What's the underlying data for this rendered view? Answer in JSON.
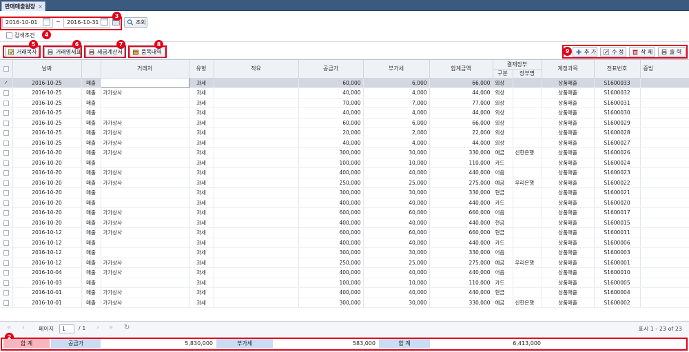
{
  "tab": {
    "title": "판매매출원장",
    "close": "×"
  },
  "search": {
    "date_from": "2016-10-01",
    "date_to": "2016-10-31",
    "tilde": "~",
    "query_label": "조회",
    "condition_label": "검색조건"
  },
  "toolbar_left": [
    {
      "label": "거래복사"
    },
    {
      "label": "거래명세표"
    },
    {
      "label": "세금계산서"
    },
    {
      "label": "품목내역"
    }
  ],
  "toolbar_right": [
    {
      "label": "추 가"
    },
    {
      "label": "수 정"
    },
    {
      "label": "삭 제"
    },
    {
      "label": "출 력"
    }
  ],
  "badges": [
    "2",
    "3",
    "4",
    "5",
    "6",
    "7",
    "8",
    "9"
  ],
  "table": {
    "headers": {
      "date": "날짜",
      "trader": "거래처",
      "type": "유형",
      "memo": "적요",
      "supply": "공급가",
      "vat": "부가세",
      "total": "합계금액",
      "settlement": "결재장부",
      "kind": "구분",
      "ledger": "장부명",
      "account": "계정과목",
      "slip": "전표번호",
      "proof": "증빙"
    },
    "rows": [
      {
        "date": "2016-10-25",
        "cat": "매출",
        "trader": "",
        "type": "과세",
        "memo": "",
        "supply": "60,000",
        "vat": "6,000",
        "total": "66,000",
        "kind": "외상",
        "ledger": "",
        "account": "상품매출",
        "slip": "S1600033",
        "sel": true
      },
      {
        "date": "2016-10-25",
        "cat": "매출",
        "trader": "가가상사",
        "type": "과세",
        "memo": "",
        "supply": "40,000",
        "vat": "4,000",
        "total": "44,000",
        "kind": "외상",
        "ledger": "",
        "account": "상품매출",
        "slip": "S1600032"
      },
      {
        "date": "2016-10-25",
        "cat": "매출",
        "trader": "",
        "type": "과세",
        "memo": "",
        "supply": "70,000",
        "vat": "7,000",
        "total": "77,000",
        "kind": "외상",
        "ledger": "",
        "account": "상품매출",
        "slip": "S1600031"
      },
      {
        "date": "2016-10-25",
        "cat": "매출",
        "trader": "",
        "type": "과세",
        "memo": "",
        "supply": "40,000",
        "vat": "4,000",
        "total": "44,000",
        "kind": "외상",
        "ledger": "",
        "account": "상품매출",
        "slip": "S1600030"
      },
      {
        "date": "2016-10-25",
        "cat": "매출",
        "trader": "가가상사",
        "type": "과세",
        "memo": "",
        "supply": "60,000",
        "vat": "6,000",
        "total": "66,000",
        "kind": "외상",
        "ledger": "",
        "account": "상품매출",
        "slip": "S1600029"
      },
      {
        "date": "2016-10-25",
        "cat": "매출",
        "trader": "가가상사",
        "type": "과세",
        "memo": "",
        "supply": "20,000",
        "vat": "2,000",
        "total": "22,000",
        "kind": "외상",
        "ledger": "",
        "account": "상품매출",
        "slip": "S1600028"
      },
      {
        "date": "2016-10-25",
        "cat": "매출",
        "trader": "가가상사",
        "type": "과세",
        "memo": "",
        "supply": "40,000",
        "vat": "4,000",
        "total": "44,000",
        "kind": "외상",
        "ledger": "",
        "account": "상품매출",
        "slip": "S1600027"
      },
      {
        "date": "2016-10-20",
        "cat": "매출",
        "trader": "가가상사",
        "type": "과세",
        "memo": "",
        "supply": "300,000",
        "vat": "30,000",
        "total": "330,000",
        "kind": "예금",
        "ledger": "신한은행",
        "account": "상품매출",
        "slip": "S1600026"
      },
      {
        "date": "2016-10-20",
        "cat": "매출",
        "trader": "",
        "type": "과세",
        "memo": "",
        "supply": "100,000",
        "vat": "10,000",
        "total": "110,000",
        "kind": "카드",
        "ledger": "",
        "account": "상품매출",
        "slip": "S1600024"
      },
      {
        "date": "2016-10-20",
        "cat": "매출",
        "trader": "가가상사",
        "type": "과세",
        "memo": "",
        "supply": "400,000",
        "vat": "40,000",
        "total": "440,000",
        "kind": "어음",
        "ledger": "",
        "account": "상품매출",
        "slip": "S1600023"
      },
      {
        "date": "2016-10-20",
        "cat": "매출",
        "trader": "가가상사",
        "type": "과세",
        "memo": "",
        "supply": "250,000",
        "vat": "25,000",
        "total": "275,000",
        "kind": "예금",
        "ledger": "우리은행",
        "account": "상품매출",
        "slip": "S1600022"
      },
      {
        "date": "2016-10-20",
        "cat": "매출",
        "trader": "",
        "type": "과세",
        "memo": "",
        "supply": "300,000",
        "vat": "30,000",
        "total": "330,000",
        "kind": "현금",
        "ledger": "",
        "account": "상품매출",
        "slip": "S1600021"
      },
      {
        "date": "2016-10-20",
        "cat": "매출",
        "trader": "",
        "type": "과세",
        "memo": "",
        "supply": "400,000",
        "vat": "40,000",
        "total": "440,000",
        "kind": "카드",
        "ledger": "",
        "account": "상품매출",
        "slip": "S1600020"
      },
      {
        "date": "2016-10-20",
        "cat": "매출",
        "trader": "가가상사",
        "type": "과세",
        "memo": "",
        "supply": "600,000",
        "vat": "60,000",
        "total": "660,000",
        "kind": "어음",
        "ledger": "",
        "account": "상품매출",
        "slip": "S1600017"
      },
      {
        "date": "2016-10-20",
        "cat": "매출",
        "trader": "가가상사",
        "type": "과세",
        "memo": "",
        "supply": "400,000",
        "vat": "40,000",
        "total": "440,000",
        "kind": "현금",
        "ledger": "",
        "account": "상품매출",
        "slip": "S1600015"
      },
      {
        "date": "2016-10-12",
        "cat": "매출",
        "trader": "가가상사",
        "type": "과세",
        "memo": "",
        "supply": "600,000",
        "vat": "60,000",
        "total": "660,000",
        "kind": "현금",
        "ledger": "",
        "account": "상품매출",
        "slip": "S1600011"
      },
      {
        "date": "2016-10-12",
        "cat": "매출",
        "trader": "",
        "type": "과세",
        "memo": "",
        "supply": "400,000",
        "vat": "40,000",
        "total": "440,000",
        "kind": "카드",
        "ledger": "",
        "account": "상품매출",
        "slip": "S1600006"
      },
      {
        "date": "2016-10-12",
        "cat": "매출",
        "trader": "",
        "type": "과세",
        "memo": "",
        "supply": "300,000",
        "vat": "30,000",
        "total": "330,000",
        "kind": "어음",
        "ledger": "",
        "account": "상품매출",
        "slip": "S1600003"
      },
      {
        "date": "2016-10-12",
        "cat": "매출",
        "trader": "가가상사",
        "type": "과세",
        "memo": "",
        "supply": "250,000",
        "vat": "25,000",
        "total": "275,000",
        "kind": "예금",
        "ledger": "우리은행",
        "account": "상품매출",
        "slip": "S1600001"
      },
      {
        "date": "2016-10-04",
        "cat": "매출",
        "trader": "가가상사",
        "type": "과세",
        "memo": "",
        "supply": "400,000",
        "vat": "40,000",
        "total": "440,000",
        "kind": "어음",
        "ledger": "",
        "account": "상품매출",
        "slip": "S1600010"
      },
      {
        "date": "2016-10-03",
        "cat": "매출",
        "trader": "",
        "type": "과세",
        "memo": "",
        "supply": "100,000",
        "vat": "10,000",
        "total": "110,000",
        "kind": "카드",
        "ledger": "",
        "account": "상품매출",
        "slip": "S1600005"
      },
      {
        "date": "2016-10-01",
        "cat": "매출",
        "trader": "가가상사",
        "type": "과세",
        "memo": "",
        "supply": "400,000",
        "vat": "40,000",
        "total": "440,000",
        "kind": "현금",
        "ledger": "",
        "account": "상품매출",
        "slip": "S1600004"
      },
      {
        "date": "2016-10-01",
        "cat": "매출",
        "trader": "가가상사",
        "type": "과세",
        "memo": "",
        "supply": "300,000",
        "vat": "30,000",
        "total": "330,000",
        "kind": "예금",
        "ledger": "신한은행",
        "account": "상품매출",
        "slip": "S1600002"
      }
    ]
  },
  "pager": {
    "page_label": "페이지",
    "page": "1",
    "of": "/ 1",
    "display": "표시 1 - 23 of 23"
  },
  "summary": {
    "total_label": "합 계",
    "supply_label": "공급가",
    "supply_value": "5,830,000",
    "vat_label": "부가세",
    "vat_value": "583,000",
    "sum_label": "합 계",
    "sum_value": "6,413,000"
  },
  "colors": {
    "accent": "#e1001a",
    "header_bg": "#eef2f7",
    "selected_row": "#d3d8e0",
    "tabbar": "#3b5a80"
  }
}
